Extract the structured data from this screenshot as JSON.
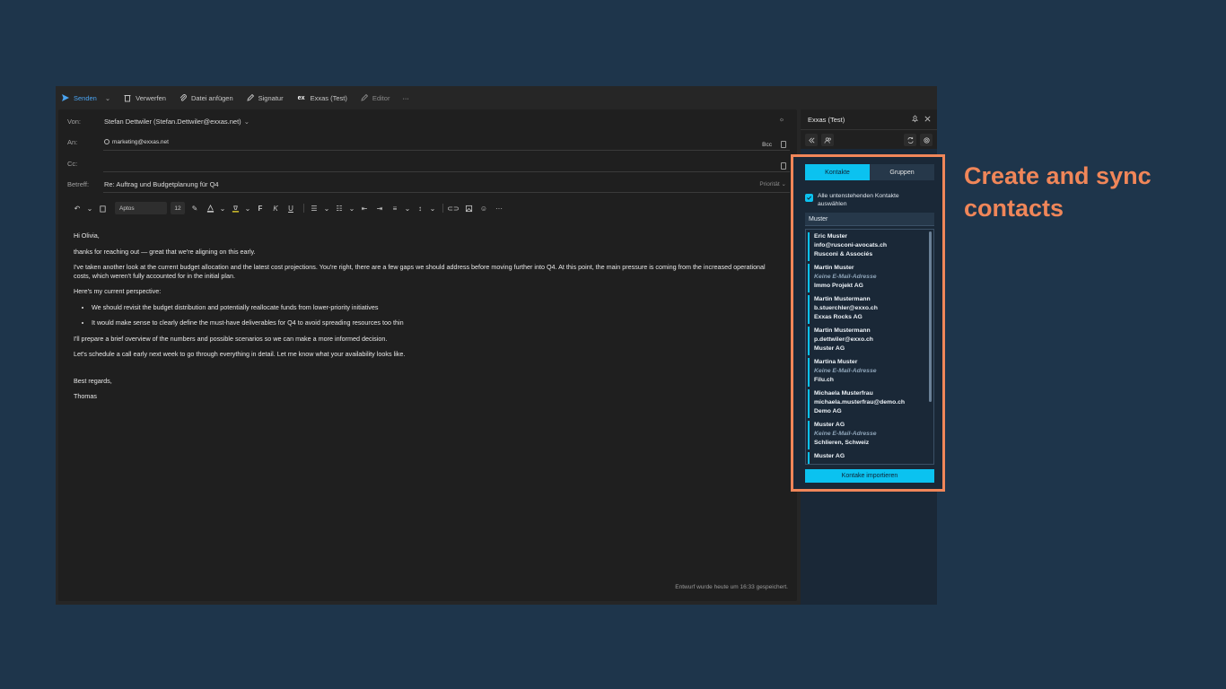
{
  "toolbar": {
    "send": "Senden",
    "discard": "Verwerfen",
    "attach": "Datei anfügen",
    "signature": "Signatur",
    "exxas": "Exxas (Test)",
    "editor": "Editor",
    "more": "···"
  },
  "header": {
    "from_label": "Von:",
    "from_value": "Stefan Dettwiler (Stefan.Dettwiler@exxas.net)",
    "to_label": "An:",
    "to_value": "marketing@exxas.net",
    "bcc": "Bcc",
    "cc_label": "Cc:",
    "subject_label": "Betreff:",
    "subject_value": "Re: Auftrag und Budgetplanung für Q4",
    "priority": "Priorität"
  },
  "format": {
    "font": "Aptos",
    "size": "12",
    "bold": "F",
    "italic": "K",
    "underline": "U"
  },
  "body": {
    "greeting": "Hi Olivia,",
    "p1": "thanks for reaching out — great that we're aligning on this early.",
    "p2": "I've taken another look at the current budget allocation and the latest cost projections. You're right, there are a few gaps we should address before moving further into Q4. At this point, the main pressure is coming from the increased operational costs, which weren't fully accounted for in the initial plan.",
    "p3": "Here's my current perspective:",
    "bullet1": "We should revisit the budget distribution and potentially reallocate funds from lower-priority initiatives",
    "bullet2": "It would make sense to clearly define the must-have deliverables for Q4 to avoid spreading resources too thin",
    "p4": "I'll prepare a brief overview of the numbers and possible scenarios so we can make a more informed decision.",
    "p5": "Let's schedule a call early next week to go through everything in detail. Let me know what your availability looks like.",
    "closing": "Best regards,",
    "signature": "Thomas"
  },
  "saved_status": "Entwurf wurde heute um 16:33 gespeichert.",
  "addin": {
    "title": "Exxas (Test)",
    "tab_contacts": "Kontakte",
    "tab_groups": "Gruppen",
    "select_all_1": "Alle untenstehenden Kontakte",
    "select_all_2": "auswählen",
    "search_value": "Muster",
    "import_button": "Kontake importieren",
    "contacts": [
      {
        "name": "Eric Muster",
        "email": "info@rusconi-avocats.ch",
        "company": "Rusconi & Associés",
        "nomail": false
      },
      {
        "name": "Martin Muster",
        "email": "Keine E-Mail-Adresse",
        "company": "Immo Projekt AG",
        "nomail": true
      },
      {
        "name": "Martin Mustermann",
        "email": "b.stuerchler@exxo.ch",
        "company": "Exxas Rocks AG",
        "nomail": false
      },
      {
        "name": "Martin Mustermann",
        "email": "p.dettwiler@exxo.ch",
        "company": "Muster AG",
        "nomail": false
      },
      {
        "name": "Martina Muster",
        "email": "Keine E-Mail-Adresse",
        "company": "Filu.ch",
        "nomail": true
      },
      {
        "name": "Michaela Musterfrau",
        "email": "michaela.musterfrau@demo.ch",
        "company": "Demo AG",
        "nomail": false
      },
      {
        "name": "Muster AG",
        "email": "Keine E-Mail-Adresse",
        "company": "Schlieren, Schweiz",
        "nomail": true
      },
      {
        "name": "Muster AG",
        "email": "",
        "company": "",
        "nomail": false
      }
    ]
  },
  "caption": "Create and sync contacts",
  "colors": {
    "accent": "#0bc2f0",
    "highlight": "#f08659",
    "background": "#1e354b"
  }
}
